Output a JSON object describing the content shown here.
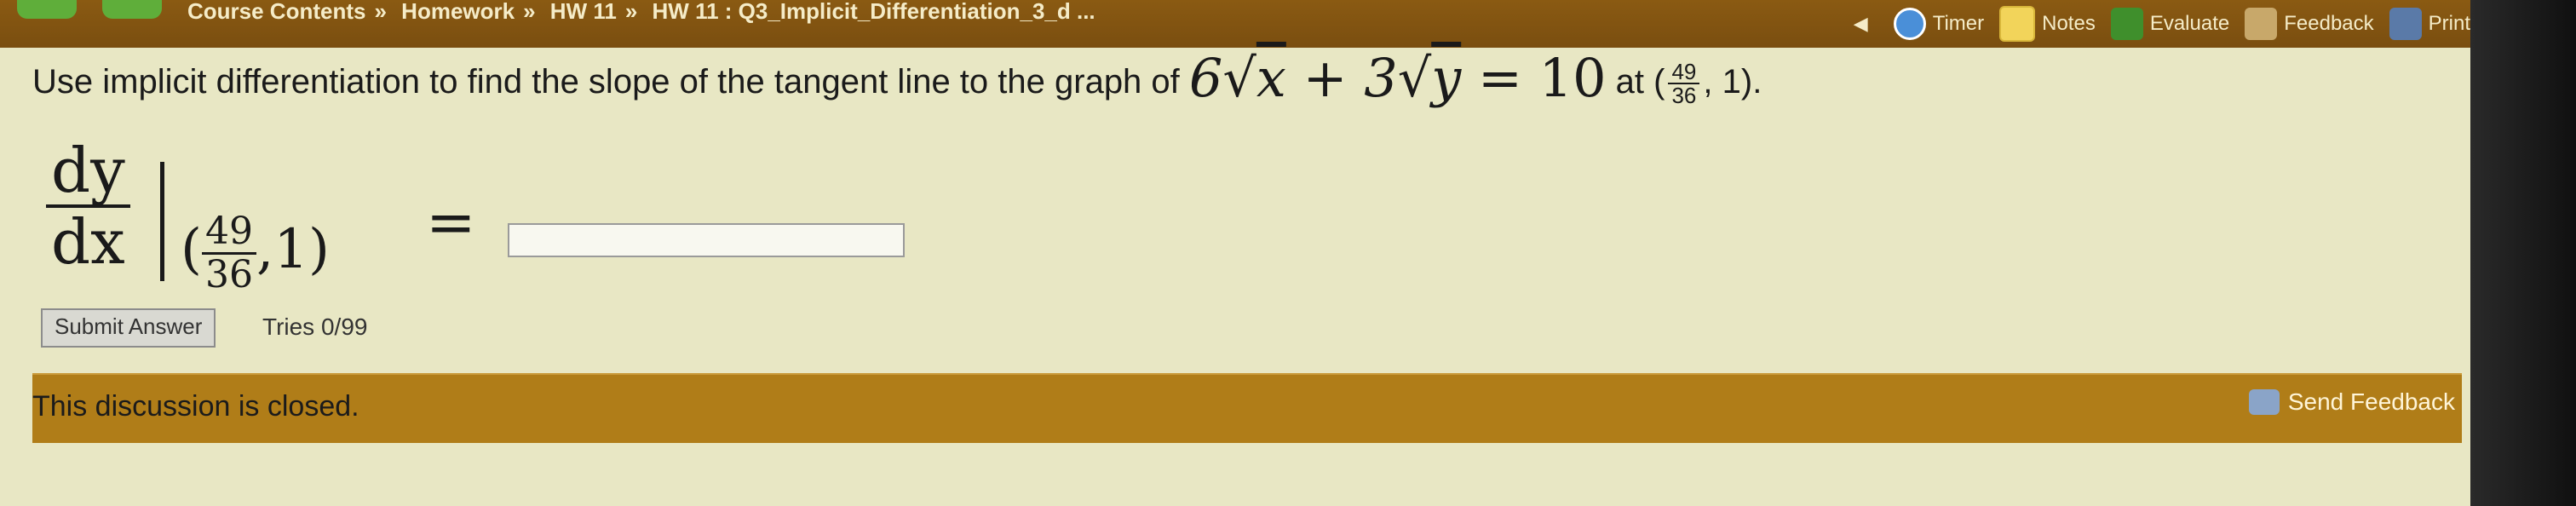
{
  "nav": {
    "breadcrumb": [
      "Course Contents",
      "Homework",
      "HW 11",
      "HW 11 : Q3_Implicit_Differentiation_3_d ..."
    ],
    "tools": [
      {
        "name": "timer",
        "label": "Timer"
      },
      {
        "name": "notes",
        "label": "Notes"
      },
      {
        "name": "evaluate",
        "label": "Evaluate"
      },
      {
        "name": "feedback",
        "label": "Feedback"
      },
      {
        "name": "print",
        "label": "Print"
      }
    ]
  },
  "question": {
    "prompt": "Use implicit differentiation to find the slope of the tangent line to the graph of",
    "equation": {
      "coef1": "6",
      "var1": "x",
      "plus": "+",
      "coef2": "3",
      "var2": "y",
      "equals": "=",
      "rhs": "10"
    },
    "at_word": "at",
    "point": {
      "num": "49",
      "den": "36",
      "y": "1"
    }
  },
  "derivative": {
    "numerator": "dy",
    "denominator": "dx",
    "point_num": "49",
    "point_den": "36",
    "point_y": "1",
    "equals": "="
  },
  "answer": {
    "value": ""
  },
  "submit": {
    "label": "Submit Answer"
  },
  "tries": {
    "text": "Tries 0/99"
  },
  "discussion": {
    "closed_text": "This discussion is closed.",
    "send_feedback": "Send Feedback"
  }
}
